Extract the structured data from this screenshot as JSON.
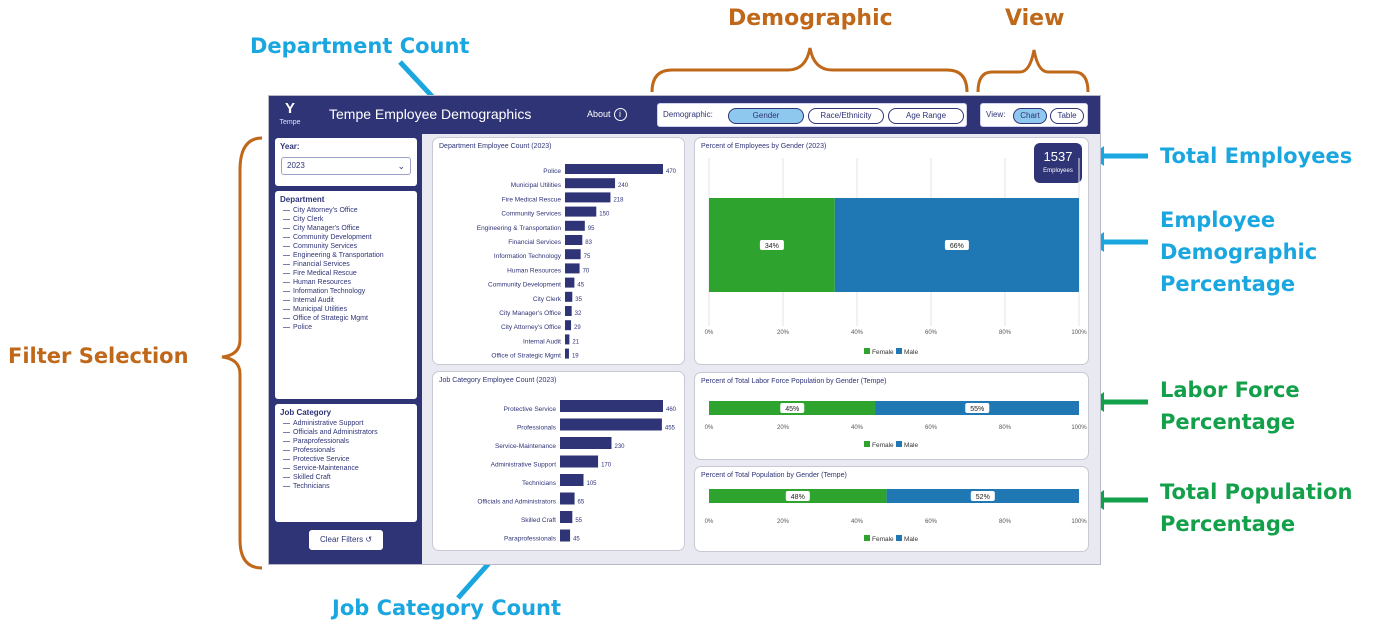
{
  "annotations": {
    "demographic": "Demographic",
    "view": "View",
    "department_count": "Department Count",
    "filter_selection": "Filter Selection",
    "job_category_count": "Job Category Count",
    "total_employees": "Total Employees",
    "employee_demographic_percentage": [
      "Employee",
      "Demographic",
      "Percentage"
    ],
    "labor_force_percentage": [
      "Labor Force",
      "Percentage"
    ],
    "total_population_percentage": [
      "Total Population",
      "Percentage"
    ]
  },
  "colors": {
    "navy": "#2f3477",
    "green": "#2ea32e",
    "blue": "#1f77b4",
    "accent_pill": "#8fc8ef"
  },
  "header": {
    "logo_text": "Tempe",
    "title": "Tempe Employee Demographics",
    "about_label": "About",
    "about_icon": "info-icon",
    "demographic_label": "Demographic:",
    "demographic_options": [
      "Gender",
      "Race/Ethnicity",
      "Age Range"
    ],
    "demographic_selected": "Gender",
    "view_label": "View:",
    "view_options": [
      "Chart",
      "Table"
    ],
    "view_selected": "Chart"
  },
  "sidebar": {
    "year_label": "Year:",
    "year_value": "2023",
    "department_label": "Department",
    "departments": [
      "City Attorney's Office",
      "City Clerk",
      "City Manager's Office",
      "Community Development",
      "Community Services",
      "Engineering & Transportation",
      "Financial Services",
      "Fire Medical Rescue",
      "Human Resources",
      "Information Technology",
      "Internal Audit",
      "Municipal Utilities",
      "Office of Strategic Mgmt",
      "Police"
    ],
    "job_category_label": "Job Category",
    "job_categories": [
      "Administrative Support",
      "Officials and Administrators",
      "Paraprofessionals",
      "Professionals",
      "Protective Service",
      "Service-Maintenance",
      "Skilled Craft",
      "Technicians"
    ],
    "clear_filters_label": "Clear Filters"
  },
  "department_chart": {
    "title": "Department Employee Count (2023)",
    "categories": [
      "Police",
      "Municipal Utilities",
      "Fire Medical Rescue",
      "Community Services",
      "Engineering & Transportation",
      "Financial Services",
      "Information Technology",
      "Human Resources",
      "Community Development",
      "City Clerk",
      "City Manager's Office",
      "City Attorney's Office",
      "Internal Audit",
      "Office of Strategic Mgmt"
    ],
    "values": [
      470,
      240,
      218,
      150,
      95,
      83,
      75,
      70,
      45,
      35,
      32,
      29,
      21,
      19
    ]
  },
  "job_chart": {
    "title": "Job Category Employee Count (2023)",
    "categories": [
      "Protective Service",
      "Professionals",
      "Service-Maintenance",
      "Administrative Support",
      "Technicians",
      "Officials and Administrators",
      "Skilled Craft",
      "Paraprofessionals"
    ],
    "values": [
      460,
      455,
      230,
      170,
      105,
      65,
      55,
      45
    ]
  },
  "gender_chart": {
    "title": "Percent of Employees by Gender (2023)",
    "segments": [
      {
        "label": "Female",
        "value": 34,
        "text": "34%"
      },
      {
        "label": "Male",
        "value": 66,
        "text": "66%"
      }
    ],
    "ticks": [
      "0%",
      "20%",
      "40%",
      "60%",
      "80%",
      "100%"
    ],
    "legend": [
      "Female",
      "Male"
    ],
    "total_value": "1537",
    "total_label": "Employees"
  },
  "labor_chart": {
    "title": "Percent of Total Labor Force Population by Gender (Tempe)",
    "segments": [
      {
        "label": "Female",
        "value": 45,
        "text": "45%"
      },
      {
        "label": "Male",
        "value": 55,
        "text": "55%"
      }
    ],
    "ticks": [
      "0%",
      "20%",
      "40%",
      "60%",
      "80%",
      "100%"
    ],
    "legend": [
      "Female",
      "Male"
    ]
  },
  "population_chart": {
    "title": "Percent of Total Population by Gender (Tempe)",
    "segments": [
      {
        "label": "Female",
        "value": 48,
        "text": "48%"
      },
      {
        "label": "Male",
        "value": 52,
        "text": "52%"
      }
    ],
    "ticks": [
      "0%",
      "20%",
      "40%",
      "60%",
      "80%",
      "100%"
    ],
    "legend": [
      "Female",
      "Male"
    ]
  }
}
